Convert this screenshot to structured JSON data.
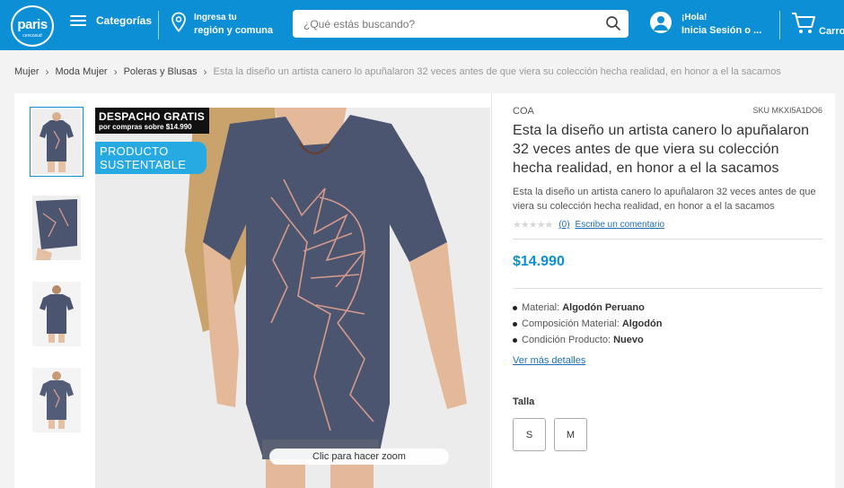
{
  "header": {
    "logo": {
      "brand": "paris",
      "subtitle": "cencosud"
    },
    "menu_label": "Categorías",
    "region": {
      "line1": "Ingresa tu",
      "line2": "región y comuna"
    },
    "search": {
      "placeholder": "¿Qué estás buscando?"
    },
    "account": {
      "line1": "¡Hola!",
      "line2": "Inicia Sesión o ..."
    },
    "cart_label": "Carro",
    "colors": {
      "header_bg": "#0d8fd6"
    }
  },
  "breadcrumb": {
    "items": [
      "Mujer",
      "Moda Mujer",
      "Poleras y Blusas"
    ],
    "current": "Esta la diseño un artista canero lo apuñalaron 32 veces antes de que viera su colección hecha realidad, en honor a el la sacamos"
  },
  "gallery": {
    "thumbnails": [
      {
        "name": "front-view",
        "selected": true
      },
      {
        "name": "side-detail",
        "selected": false
      },
      {
        "name": "back-view",
        "selected": false
      },
      {
        "name": "front-flat",
        "selected": false
      }
    ],
    "badge_shipping": {
      "title": "DESPACHO GRATIS",
      "subtitle": "por compras sobre $14.990"
    },
    "badge_eco": {
      "line1": "PRODUCTO",
      "line2": "SUSTENTABLE"
    },
    "zoom_label": "Clic para hacer zoom",
    "shirt_color": "#4b5570",
    "print_color": "#d59a8c"
  },
  "product": {
    "brand": "COA",
    "sku": "SKU MKXI5A1DO6",
    "title": "Esta la diseño un artista canero lo apuñalaron 32 veces antes de que viera su colección hecha realidad, en honor a el la sacamos",
    "description": "Esta la diseño un artista canero lo apuñalaron 32 veces antes de que viera su colección hecha realidad, en honor a el la sacamos",
    "rating": {
      "stars": "★★★★★",
      "value": 0,
      "count_label": "(0)",
      "write_review": "Escribe un comentario"
    },
    "price": "$14.990",
    "price_color": "#0d8fd6",
    "specs": [
      {
        "label": "Material:",
        "value": "Algodón Peruano"
      },
      {
        "label": "Composición Material:",
        "value": "Algodón"
      },
      {
        "label": "Condición Producto:",
        "value": "Nuevo"
      }
    ],
    "more_details": "Ver más detalles",
    "size_label": "Talla",
    "sizes": [
      "S",
      "M"
    ]
  }
}
